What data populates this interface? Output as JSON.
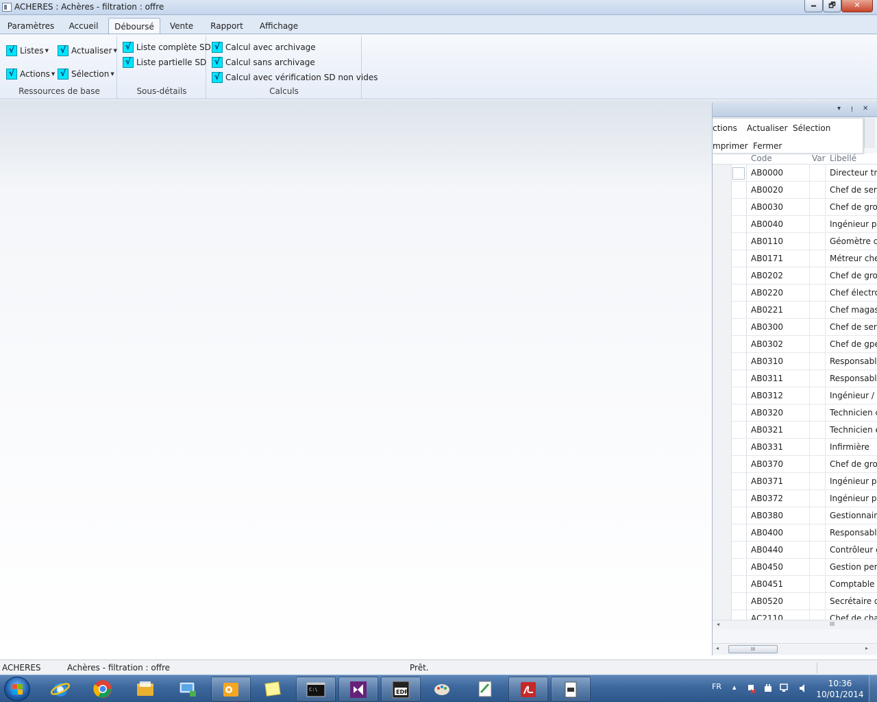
{
  "window": {
    "title": "ACHERES : Achères - filtration : offre",
    "min_glyph": "🗕",
    "max_glyph": "🗗",
    "close_glyph": "✕"
  },
  "ribbon": {
    "tabs": [
      "Paramètres",
      "Accueil",
      "Déboursé",
      "Vente",
      "Rapport",
      "Affichage"
    ],
    "active_tab": "Déboursé",
    "groups": {
      "ressources": {
        "label": "Ressources de base",
        "buttons": [
          "Listes",
          "Actualiser",
          "Actions",
          "Sélection"
        ]
      },
      "sous_details": {
        "label": "Sous-détails",
        "buttons": [
          "Liste complète SD",
          "Liste partielle SD"
        ]
      },
      "calculs": {
        "label": "Calculs",
        "buttons": [
          "Calcul avec archivage",
          "Calcul sans archivage",
          "Calcul avec vérification SD non vides"
        ]
      }
    },
    "check_glyph": "√"
  },
  "panel": {
    "header_icons": [
      "▾",
      "ᴉ",
      "✕"
    ],
    "menu": [
      "ctions",
      "Actualiser",
      "Sélection",
      "mprimer",
      "Fermer"
    ],
    "columns": [
      "Code",
      "Var",
      "Libellé"
    ],
    "rows": [
      {
        "code": "AB0000",
        "libelle": "Directeur tra"
      },
      {
        "code": "AB0020",
        "libelle": "Chef de serv"
      },
      {
        "code": "AB0030",
        "libelle": "Chef de grou"
      },
      {
        "code": "AB0040",
        "libelle": "Ingénieur pr"
      },
      {
        "code": "AB0110",
        "libelle": "Géomètre co"
      },
      {
        "code": "AB0171",
        "libelle": "Métreur che"
      },
      {
        "code": "AB0202",
        "libelle": "Chef de grou"
      },
      {
        "code": "AB0220",
        "libelle": "Chef électro"
      },
      {
        "code": "AB0221",
        "libelle": "Chef magasi"
      },
      {
        "code": "AB0300",
        "libelle": "Chef de serv"
      },
      {
        "code": "AB0302",
        "libelle": "Chef de gpe"
      },
      {
        "code": "AB0310",
        "libelle": "Responsable"
      },
      {
        "code": "AB0311",
        "libelle": "Responsable"
      },
      {
        "code": "AB0312",
        "libelle": "Ingénieur / p"
      },
      {
        "code": "AB0320",
        "libelle": "Technicien c"
      },
      {
        "code": "AB0321",
        "libelle": "Technicien e"
      },
      {
        "code": "AB0331",
        "libelle": "Infirmière"
      },
      {
        "code": "AB0370",
        "libelle": "Chef de grou"
      },
      {
        "code": "AB0371",
        "libelle": "Ingénieur pr"
      },
      {
        "code": "AB0372",
        "libelle": "Ingénieur pl"
      },
      {
        "code": "AB0380",
        "libelle": "Gestionnaire"
      },
      {
        "code": "AB0400",
        "libelle": "Responsable"
      },
      {
        "code": "AB0440",
        "libelle": "Contrôleur g"
      },
      {
        "code": "AB0450",
        "libelle": "Gestion pers"
      },
      {
        "code": "AB0451",
        "libelle": "Comptable"
      },
      {
        "code": "AB0520",
        "libelle": "Secrétaire di"
      },
      {
        "code": "AC2110",
        "libelle": "Chef de cha"
      }
    ],
    "scroll_left": "◂",
    "scroll_right": "▸",
    "thumb_grip": "III"
  },
  "status": {
    "company": "ACHERES",
    "project": "Achères - filtration : offre",
    "state": "Prêt."
  },
  "taskbar": {
    "language": "FR",
    "tray_up": "▴",
    "time": "10:36",
    "date": "10/01/2014"
  }
}
